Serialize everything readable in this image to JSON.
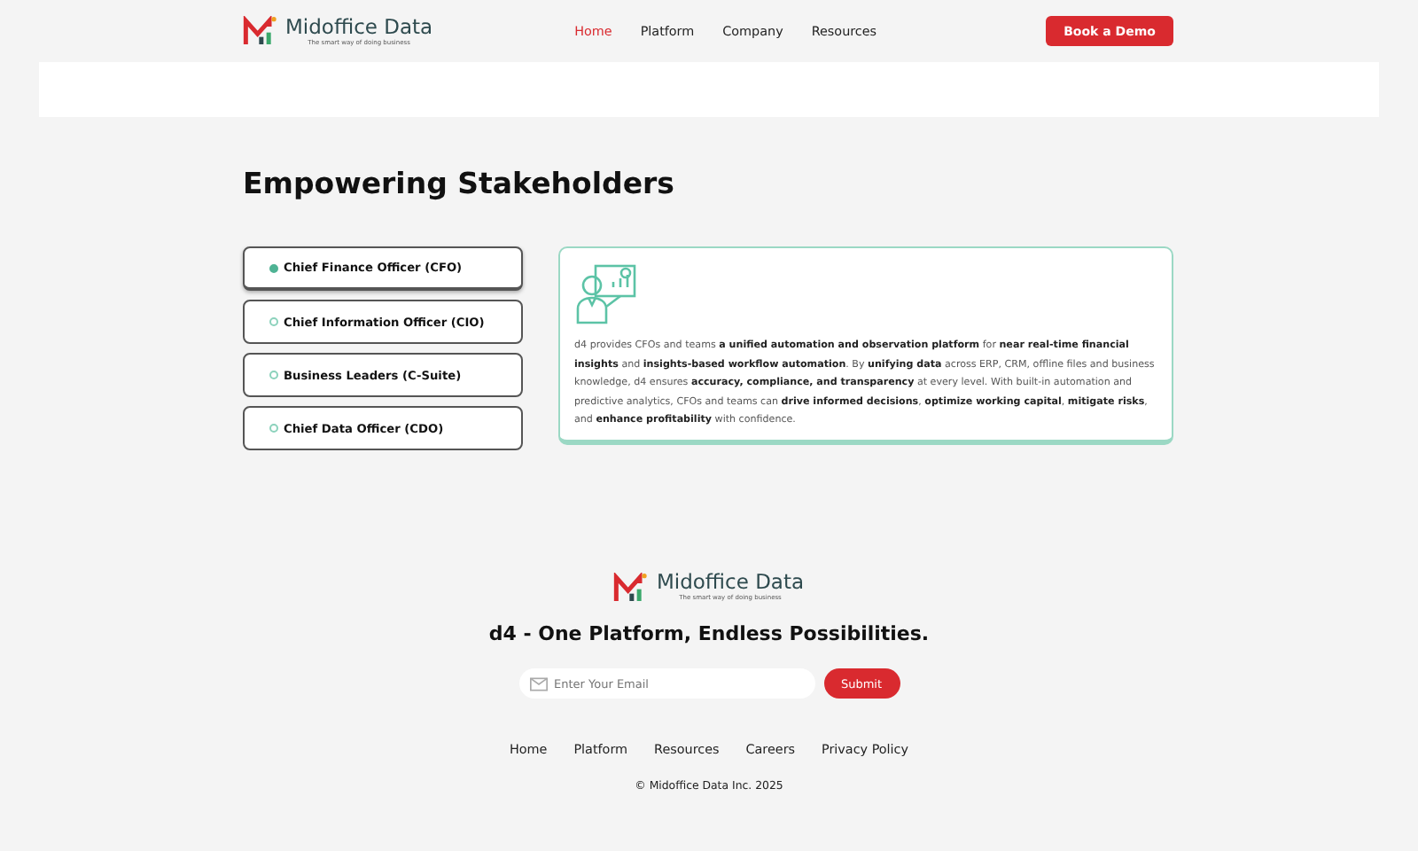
{
  "header": {
    "logo": {
      "name": "Midoffice Data",
      "tagline": "The smart way of doing business"
    },
    "nav": [
      {
        "label": "Home",
        "selected": true
      },
      {
        "label": "Platform",
        "selected": false
      },
      {
        "label": "Company",
        "selected": false
      },
      {
        "label": "Resources",
        "selected": false
      }
    ],
    "cta": "Book a Demo"
  },
  "section": {
    "title": "Empowering Stakeholders",
    "tabs": [
      {
        "label": "Chief Finance Officer (CFO)",
        "selected": true
      },
      {
        "label": "Chief Information Officer (CIO)",
        "selected": false
      },
      {
        "label": "Business Leaders (C-Suite)",
        "selected": false
      },
      {
        "label": "Chief Data Officer (CDO)",
        "selected": false
      }
    ],
    "description": "d4 provides CFOs and teams **a unified automation and observation platform** for **near real-time financial insights** and **insights-based workflow automation**. By **unifying data** across ERP, CRM, offline files and business knowledge, d4 ensures **accuracy, compliance, and transparency** at every level. With built-in automation and predictive analytics, CFOs and teams can **drive informed decisions**, **optimize working capital**, **mitigate risks**, and **enhance profitability** with confidence."
  },
  "footer": {
    "logo": {
      "name": "Midoffice Data",
      "tagline": "The smart way of doing business"
    },
    "headline": "d4 - One Platform, Endless Possibilities.",
    "email": {
      "placeholder": "Enter Your Email"
    },
    "submit": "Submit",
    "links": [
      "Home",
      "Platform",
      "Resources",
      "Careers",
      "Privacy Policy"
    ],
    "copyright": "© Midoffice Data Inc. 2025"
  }
}
